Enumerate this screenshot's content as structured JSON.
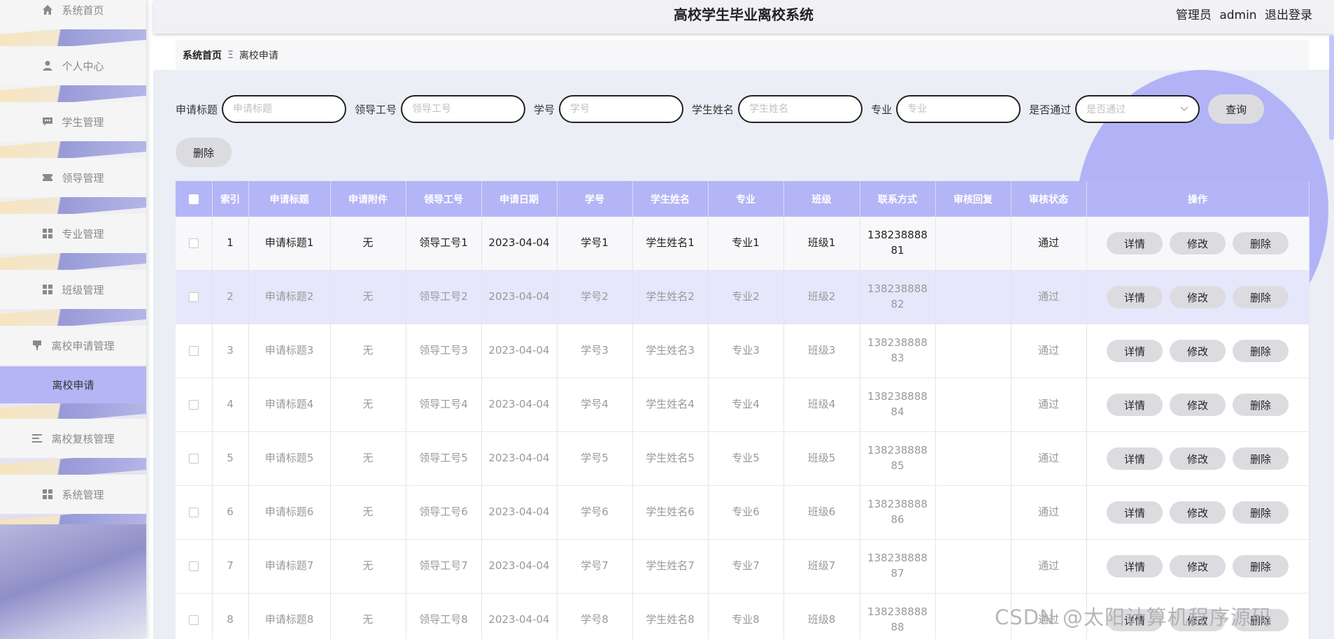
{
  "app": {
    "title": "高校学生毕业离校系统",
    "user_role": "管理员",
    "username": "admin",
    "logout": "退出登录"
  },
  "sidebar": {
    "items": [
      {
        "label": "系统首页",
        "icon": "home-icon"
      },
      {
        "label": "个人中心",
        "icon": "user-icon"
      },
      {
        "label": "学生管理",
        "icon": "chat-icon"
      },
      {
        "label": "领导管理",
        "icon": "ticket-icon"
      },
      {
        "label": "专业管理",
        "icon": "grid-icon"
      },
      {
        "label": "班级管理",
        "icon": "grid-icon"
      },
      {
        "label": "离校申请管理",
        "icon": "pin-icon"
      },
      {
        "label": "离校申请",
        "icon": "",
        "active": true
      },
      {
        "label": "离校复核管理",
        "icon": "list-icon"
      },
      {
        "label": "系统管理",
        "icon": "grid-icon"
      }
    ]
  },
  "breadcrumb": {
    "home": "系统首页",
    "separator": "Ξ",
    "current": "离校申请"
  },
  "search": {
    "fields": [
      {
        "label": "申请标题",
        "placeholder": "申请标题"
      },
      {
        "label": "领导工号",
        "placeholder": "领导工号"
      },
      {
        "label": "学号",
        "placeholder": "学号"
      },
      {
        "label": "学生姓名",
        "placeholder": "学生姓名"
      },
      {
        "label": "专业",
        "placeholder": "专业"
      }
    ],
    "select": {
      "label": "是否通过",
      "placeholder": "是否通过"
    },
    "query_button": "查询",
    "delete_button": "删除"
  },
  "table": {
    "headers": [
      "索引",
      "申请标题",
      "申请附件",
      "领导工号",
      "申请日期",
      "学号",
      "学生姓名",
      "专业",
      "班级",
      "联系方式",
      "审核回复",
      "审核状态",
      "操作"
    ],
    "rows": [
      {
        "index": "1",
        "title": "申请标题1",
        "attachment": "无",
        "leader_id": "领导工号1",
        "date": "2023-04-04",
        "student_id": "学号1",
        "name": "学生姓名1",
        "major": "专业1",
        "class": "班级1",
        "phone1": "138238888",
        "phone2": "81",
        "reply": "",
        "status": "通过"
      },
      {
        "index": "2",
        "title": "申请标题2",
        "attachment": "无",
        "leader_id": "领导工号2",
        "date": "2023-04-04",
        "student_id": "学号2",
        "name": "学生姓名2",
        "major": "专业2",
        "class": "班级2",
        "phone1": "138238888",
        "phone2": "82",
        "reply": "",
        "status": "通过"
      },
      {
        "index": "3",
        "title": "申请标题3",
        "attachment": "无",
        "leader_id": "领导工号3",
        "date": "2023-04-04",
        "student_id": "学号3",
        "name": "学生姓名3",
        "major": "专业3",
        "class": "班级3",
        "phone1": "138238888",
        "phone2": "83",
        "reply": "",
        "status": "通过"
      },
      {
        "index": "4",
        "title": "申请标题4",
        "attachment": "无",
        "leader_id": "领导工号4",
        "date": "2023-04-04",
        "student_id": "学号4",
        "name": "学生姓名4",
        "major": "专业4",
        "class": "班级4",
        "phone1": "138238888",
        "phone2": "84",
        "reply": "",
        "status": "通过"
      },
      {
        "index": "5",
        "title": "申请标题5",
        "attachment": "无",
        "leader_id": "领导工号5",
        "date": "2023-04-04",
        "student_id": "学号5",
        "name": "学生姓名5",
        "major": "专业5",
        "class": "班级5",
        "phone1": "138238888",
        "phone2": "85",
        "reply": "",
        "status": "通过"
      },
      {
        "index": "6",
        "title": "申请标题6",
        "attachment": "无",
        "leader_id": "领导工号6",
        "date": "2023-04-04",
        "student_id": "学号6",
        "name": "学生姓名6",
        "major": "专业6",
        "class": "班级6",
        "phone1": "138238888",
        "phone2": "86",
        "reply": "",
        "status": "通过"
      },
      {
        "index": "7",
        "title": "申请标题7",
        "attachment": "无",
        "leader_id": "领导工号7",
        "date": "2023-04-04",
        "student_id": "学号7",
        "name": "学生姓名7",
        "major": "专业7",
        "class": "班级7",
        "phone1": "138238888",
        "phone2": "87",
        "reply": "",
        "status": "通过"
      },
      {
        "index": "8",
        "title": "申请标题8",
        "attachment": "无",
        "leader_id": "领导工号8",
        "date": "2023-04-04",
        "student_id": "学号8",
        "name": "学生姓名8",
        "major": "专业8",
        "class": "班级8",
        "phone1": "138238888",
        "phone2": "88",
        "reply": "",
        "status": "通过"
      }
    ],
    "actions": {
      "detail": "详情",
      "edit": "修改",
      "delete": "删除"
    }
  },
  "watermark": "CSDN @太阳计算机程序源码",
  "colors": {
    "accent": "#b4b5f6",
    "active_menu": "#b5b5f5",
    "content_bg": "#ebeef4"
  }
}
